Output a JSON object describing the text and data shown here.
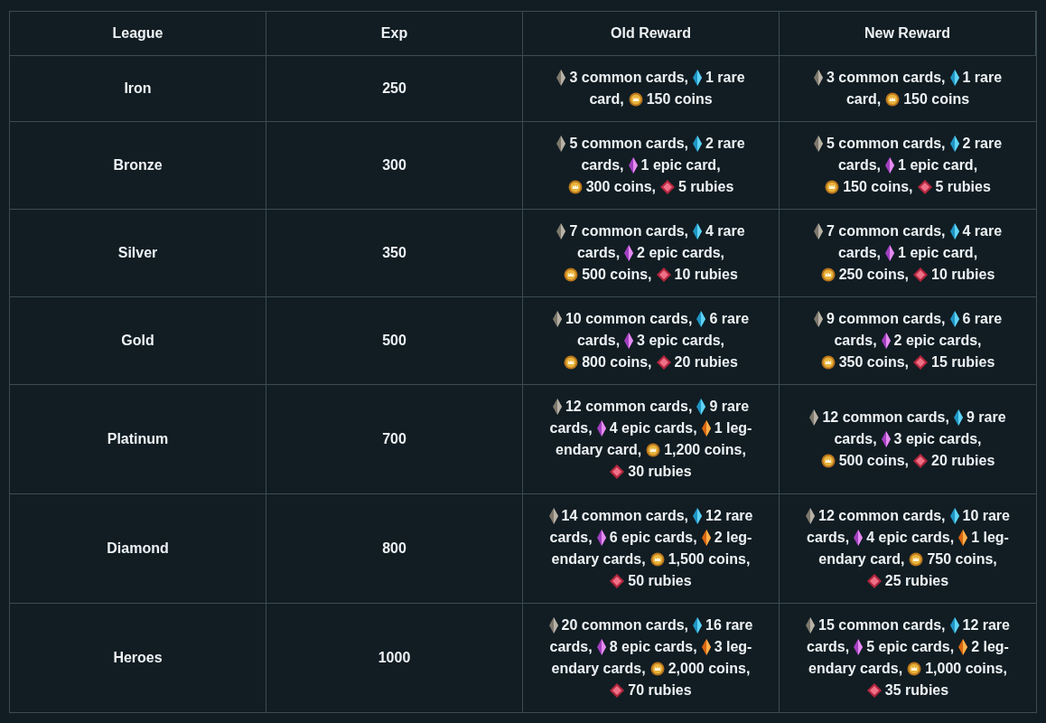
{
  "columns": [
    "League",
    "Exp",
    "Old Reward",
    "New Reward"
  ],
  "rows": [
    {
      "league": "Iron",
      "exp": "250",
      "old_reward": [
        [
          {
            "kind": "common",
            "text": "3 common cards,"
          },
          {
            "kind": "rare",
            "text": "1 rare"
          }
        ],
        [
          {
            "kind": "plain",
            "text": "card,"
          },
          {
            "kind": "coin",
            "text": "150 coins"
          }
        ]
      ],
      "new_reward": [
        [
          {
            "kind": "common",
            "text": "3 common cards,"
          },
          {
            "kind": "rare",
            "text": "1 rare"
          }
        ],
        [
          {
            "kind": "plain",
            "text": "card,"
          },
          {
            "kind": "coin",
            "text": "150 coins"
          }
        ]
      ]
    },
    {
      "league": "Bronze",
      "exp": "300",
      "old_reward": [
        [
          {
            "kind": "common",
            "text": "5 common cards,"
          },
          {
            "kind": "rare",
            "text": "2 rare"
          }
        ],
        [
          {
            "kind": "plain",
            "text": "cards,"
          },
          {
            "kind": "epic",
            "text": "1 epic card,"
          }
        ],
        [
          {
            "kind": "coin",
            "text": "300 coins,"
          },
          {
            "kind": "ruby",
            "text": "5 rubies"
          }
        ]
      ],
      "new_reward": [
        [
          {
            "kind": "common",
            "text": "5 common cards,"
          },
          {
            "kind": "rare",
            "text": "2 rare"
          }
        ],
        [
          {
            "kind": "plain",
            "text": "cards,"
          },
          {
            "kind": "epic",
            "text": "1 epic card,"
          }
        ],
        [
          {
            "kind": "coin",
            "text": "150 coins,"
          },
          {
            "kind": "ruby",
            "text": "5 rubies"
          }
        ]
      ]
    },
    {
      "league": "Silver",
      "exp": "350",
      "old_reward": [
        [
          {
            "kind": "common",
            "text": "7 common cards,"
          },
          {
            "kind": "rare",
            "text": "4 rare"
          }
        ],
        [
          {
            "kind": "plain",
            "text": "cards,"
          },
          {
            "kind": "epic",
            "text": "2 epic cards,"
          }
        ],
        [
          {
            "kind": "coin",
            "text": "500 coins,"
          },
          {
            "kind": "ruby",
            "text": "10 rubies"
          }
        ]
      ],
      "new_reward": [
        [
          {
            "kind": "common",
            "text": "7 common cards,"
          },
          {
            "kind": "rare",
            "text": "4 rare"
          }
        ],
        [
          {
            "kind": "plain",
            "text": "cards,"
          },
          {
            "kind": "epic",
            "text": "1 epic card,"
          }
        ],
        [
          {
            "kind": "coin",
            "text": "250 coins,"
          },
          {
            "kind": "ruby",
            "text": "10 rubies"
          }
        ]
      ]
    },
    {
      "league": "Gold",
      "exp": "500",
      "old_reward": [
        [
          {
            "kind": "common",
            "text": "10 common cards,"
          },
          {
            "kind": "rare",
            "text": "6 rare"
          }
        ],
        [
          {
            "kind": "plain",
            "text": "cards,"
          },
          {
            "kind": "epic",
            "text": "3 epic cards,"
          }
        ],
        [
          {
            "kind": "coin",
            "text": "800 coins,"
          },
          {
            "kind": "ruby",
            "text": "20 rubies"
          }
        ]
      ],
      "new_reward": [
        [
          {
            "kind": "common",
            "text": "9 common cards,"
          },
          {
            "kind": "rare",
            "text": "6 rare"
          }
        ],
        [
          {
            "kind": "plain",
            "text": "cards,"
          },
          {
            "kind": "epic",
            "text": "2 epic cards,"
          }
        ],
        [
          {
            "kind": "coin",
            "text": "350 coins,"
          },
          {
            "kind": "ruby",
            "text": "15 rubies"
          }
        ]
      ]
    },
    {
      "league": "Platinum",
      "exp": "700",
      "old_reward": [
        [
          {
            "kind": "common",
            "text": "12 common cards,"
          },
          {
            "kind": "rare",
            "text": "9 rare"
          }
        ],
        [
          {
            "kind": "plain",
            "text": "cards,"
          },
          {
            "kind": "epic",
            "text": "4 epic cards,"
          },
          {
            "kind": "legendary",
            "text": "1 leg-"
          }
        ],
        [
          {
            "kind": "plain",
            "text": "endary card,"
          },
          {
            "kind": "coin",
            "text": "1,200 coins,"
          }
        ],
        [
          {
            "kind": "ruby",
            "text": "30 rubies"
          }
        ]
      ],
      "new_reward": [
        [
          {
            "kind": "common",
            "text": "12 common cards,"
          },
          {
            "kind": "rare",
            "text": "9 rare"
          }
        ],
        [
          {
            "kind": "plain",
            "text": "cards,"
          },
          {
            "kind": "epic",
            "text": "3 epic cards,"
          }
        ],
        [
          {
            "kind": "coin",
            "text": "500 coins,"
          },
          {
            "kind": "ruby",
            "text": "20 rubies"
          }
        ]
      ]
    },
    {
      "league": "Diamond",
      "exp": "800",
      "old_reward": [
        [
          {
            "kind": "common",
            "text": "14 common cards,"
          },
          {
            "kind": "rare",
            "text": "12 rare"
          }
        ],
        [
          {
            "kind": "plain",
            "text": "cards,"
          },
          {
            "kind": "epic",
            "text": "6 epic cards,"
          },
          {
            "kind": "legendary",
            "text": "2 leg-"
          }
        ],
        [
          {
            "kind": "plain",
            "text": "endary cards,"
          },
          {
            "kind": "coin",
            "text": "1,500 coins,"
          }
        ],
        [
          {
            "kind": "ruby",
            "text": "50 rubies"
          }
        ]
      ],
      "new_reward": [
        [
          {
            "kind": "common",
            "text": "12 common cards,"
          },
          {
            "kind": "rare",
            "text": "10 rare"
          }
        ],
        [
          {
            "kind": "plain",
            "text": "cards,"
          },
          {
            "kind": "epic",
            "text": "4 epic cards,"
          },
          {
            "kind": "legendary",
            "text": "1 leg-"
          }
        ],
        [
          {
            "kind": "plain",
            "text": "endary card,"
          },
          {
            "kind": "coin",
            "text": "750 coins,"
          }
        ],
        [
          {
            "kind": "ruby",
            "text": "25 rubies"
          }
        ]
      ]
    },
    {
      "league": "Heroes",
      "exp": "1000",
      "old_reward": [
        [
          {
            "kind": "common",
            "text": "20 common cards,"
          },
          {
            "kind": "rare",
            "text": "16 rare"
          }
        ],
        [
          {
            "kind": "plain",
            "text": "cards,"
          },
          {
            "kind": "epic",
            "text": "8 epic cards,"
          },
          {
            "kind": "legendary",
            "text": "3 leg-"
          }
        ],
        [
          {
            "kind": "plain",
            "text": "endary cards,"
          },
          {
            "kind": "coin",
            "text": "2,000 coins,"
          }
        ],
        [
          {
            "kind": "ruby",
            "text": "70 rubies"
          }
        ]
      ],
      "new_reward": [
        [
          {
            "kind": "common",
            "text": "15 common cards,"
          },
          {
            "kind": "rare",
            "text": "12 rare"
          }
        ],
        [
          {
            "kind": "plain",
            "text": "cards,"
          },
          {
            "kind": "epic",
            "text": "5 epic cards,"
          },
          {
            "kind": "legendary",
            "text": "2 leg-"
          }
        ],
        [
          {
            "kind": "plain",
            "text": "endary cards,"
          },
          {
            "kind": "coin",
            "text": "1,000 coins,"
          }
        ],
        [
          {
            "kind": "ruby",
            "text": "35 rubies"
          }
        ]
      ]
    }
  ]
}
